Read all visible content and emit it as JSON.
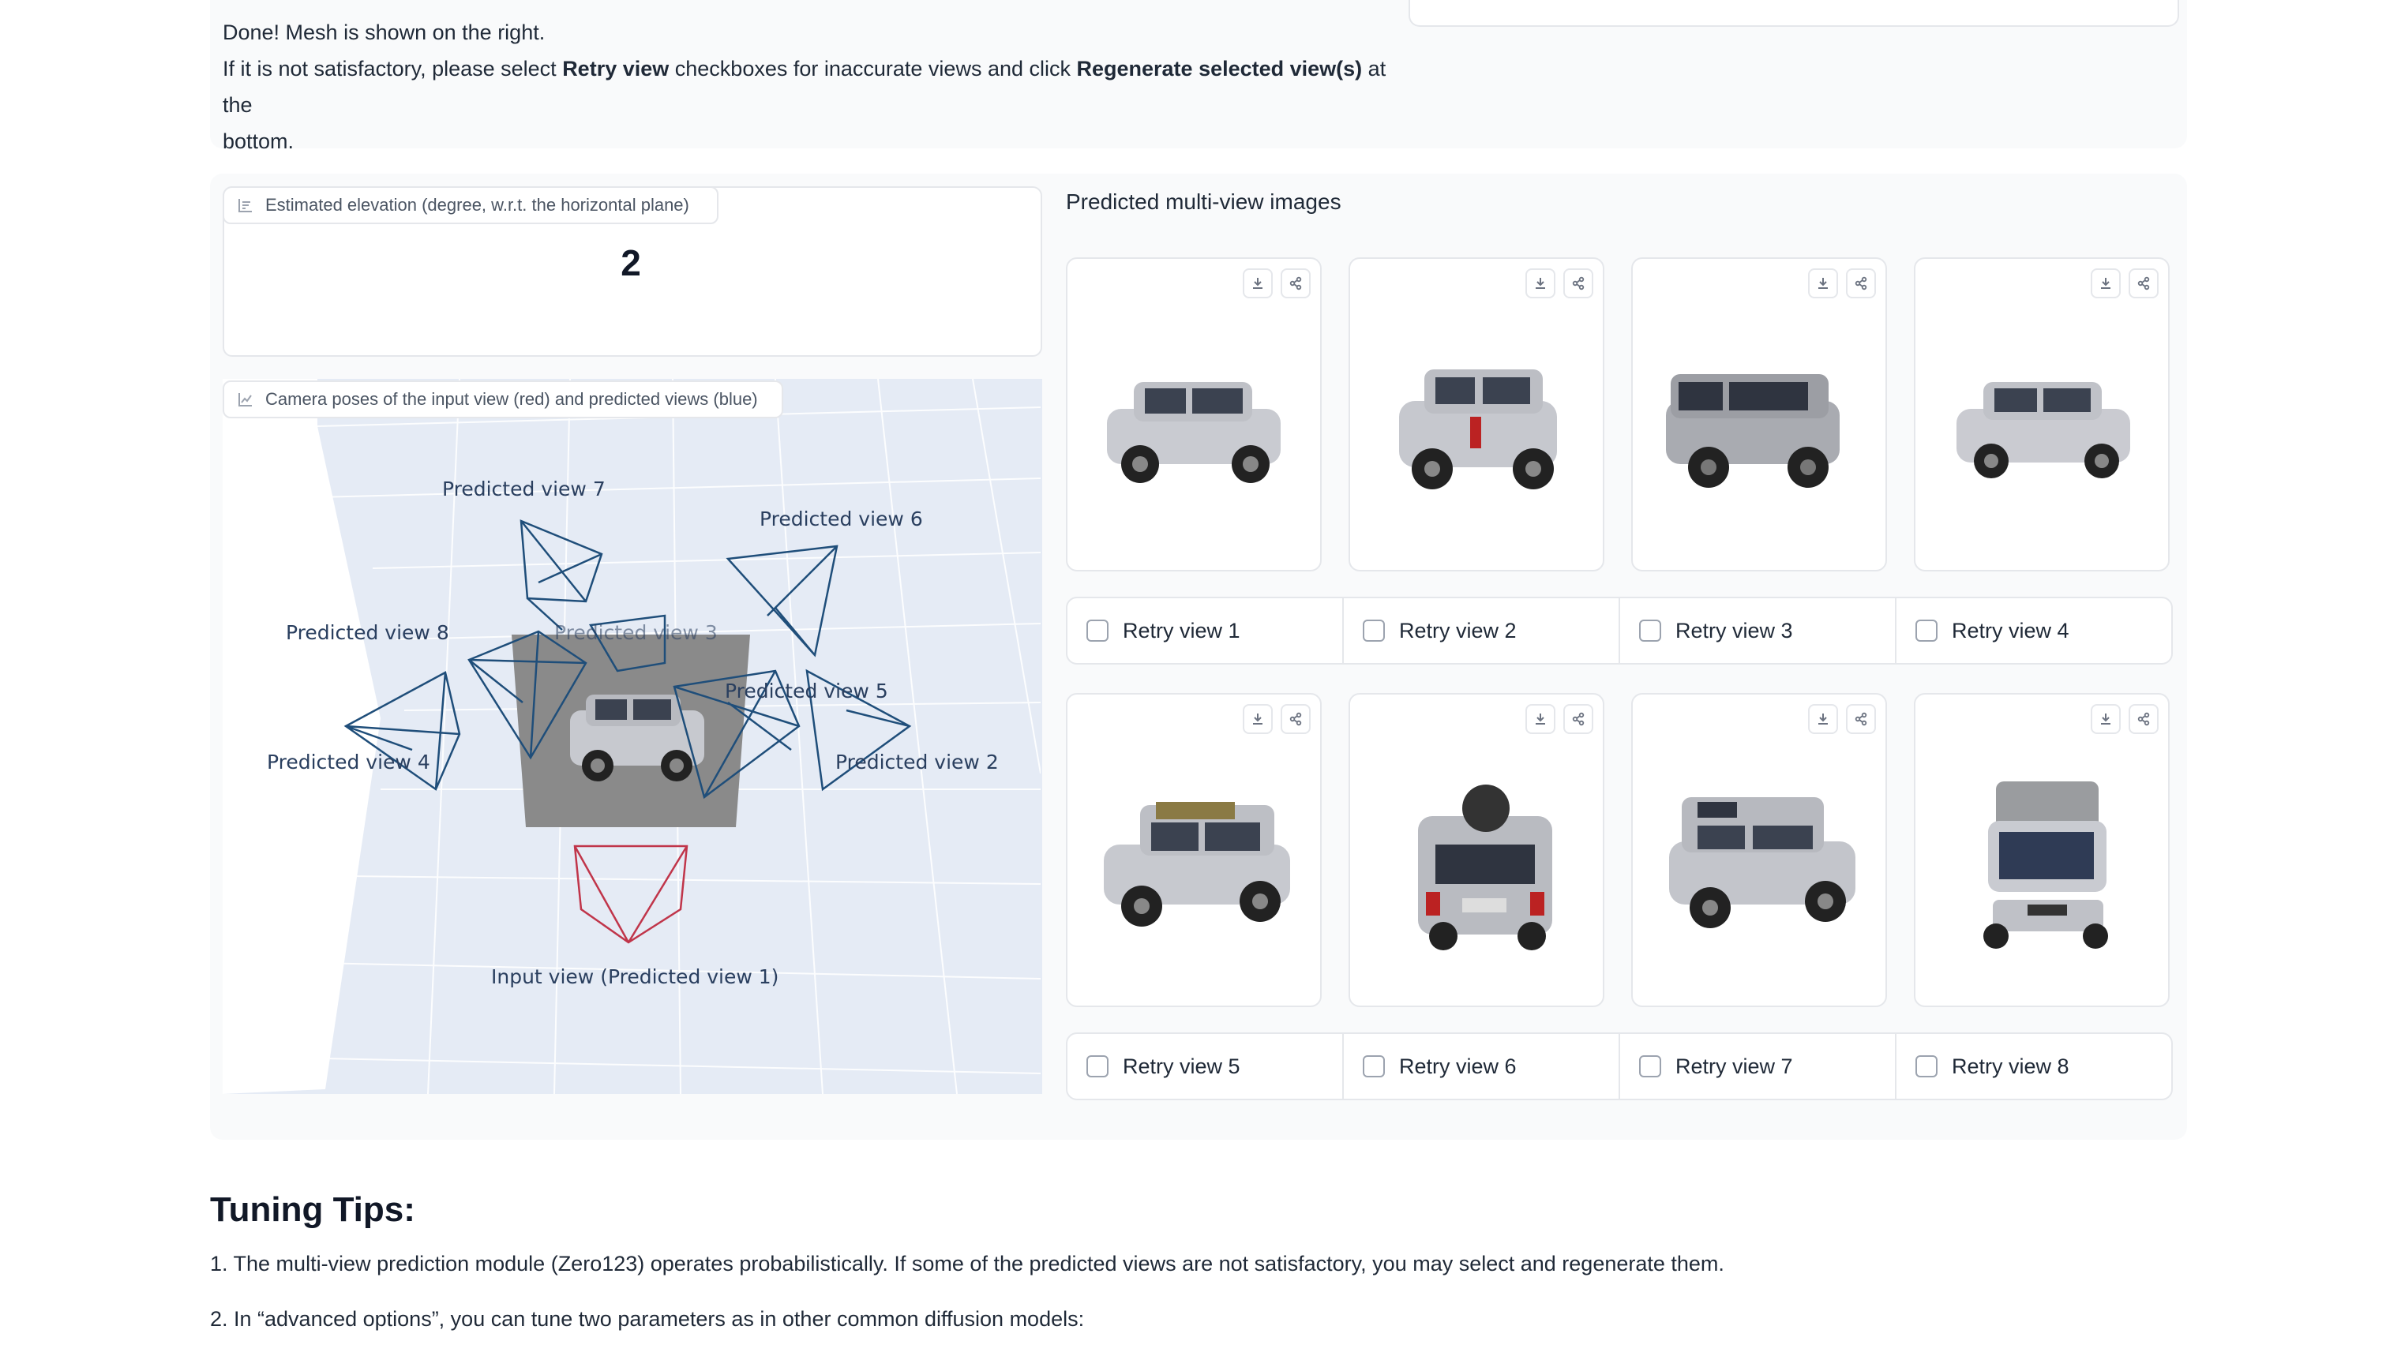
{
  "status": {
    "line1": "Done! Mesh is shown on the right.",
    "line2_prefix": "If it is not satisfactory, please select ",
    "line2_bold1": "Retry view",
    "line2_mid": " checkboxes for inaccurate views and click ",
    "line2_bold2": "Regenerate selected view(s)",
    "line2_suffix": " at the",
    "line3": "bottom."
  },
  "elevation": {
    "label": "Estimated elevation (degree, w.r.t. the horizontal plane)",
    "value": "2"
  },
  "camera_plot": {
    "label": "Camera poses of the input view (red) and predicted views (blue)",
    "view_labels": {
      "v7": "Predicted view 7",
      "v6": "Predicted view 6",
      "v8": "Predicted view 8",
      "v3": "Predicted view 3",
      "v5": "Predicted view 5",
      "v4": "Predicted view 4",
      "v2": "Predicted view 2",
      "v1": "Input view (Predicted view 1)"
    },
    "input_color": "#c0354a",
    "predicted_color": "#1f4e7a"
  },
  "multiview": {
    "title": "Predicted multi-view images",
    "views": [
      {
        "label": "Retry view 1"
      },
      {
        "label": "Retry view 2"
      },
      {
        "label": "Retry view 3"
      },
      {
        "label": "Retry view 4"
      },
      {
        "label": "Retry view 5"
      },
      {
        "label": "Retry view 6"
      },
      {
        "label": "Retry view 7"
      },
      {
        "label": "Retry view 8"
      }
    ],
    "icons": [
      "download-icon",
      "share-icon"
    ]
  },
  "tips": {
    "title": "Tuning Tips:",
    "items": [
      "1. The multi-view prediction module (Zero123) operates probabilistically. If some of the predicted views are not satisfactory, you may select and regenerate them.",
      "2. In “advanced options”, you can tune two parameters as in other common diffusion models:"
    ]
  }
}
